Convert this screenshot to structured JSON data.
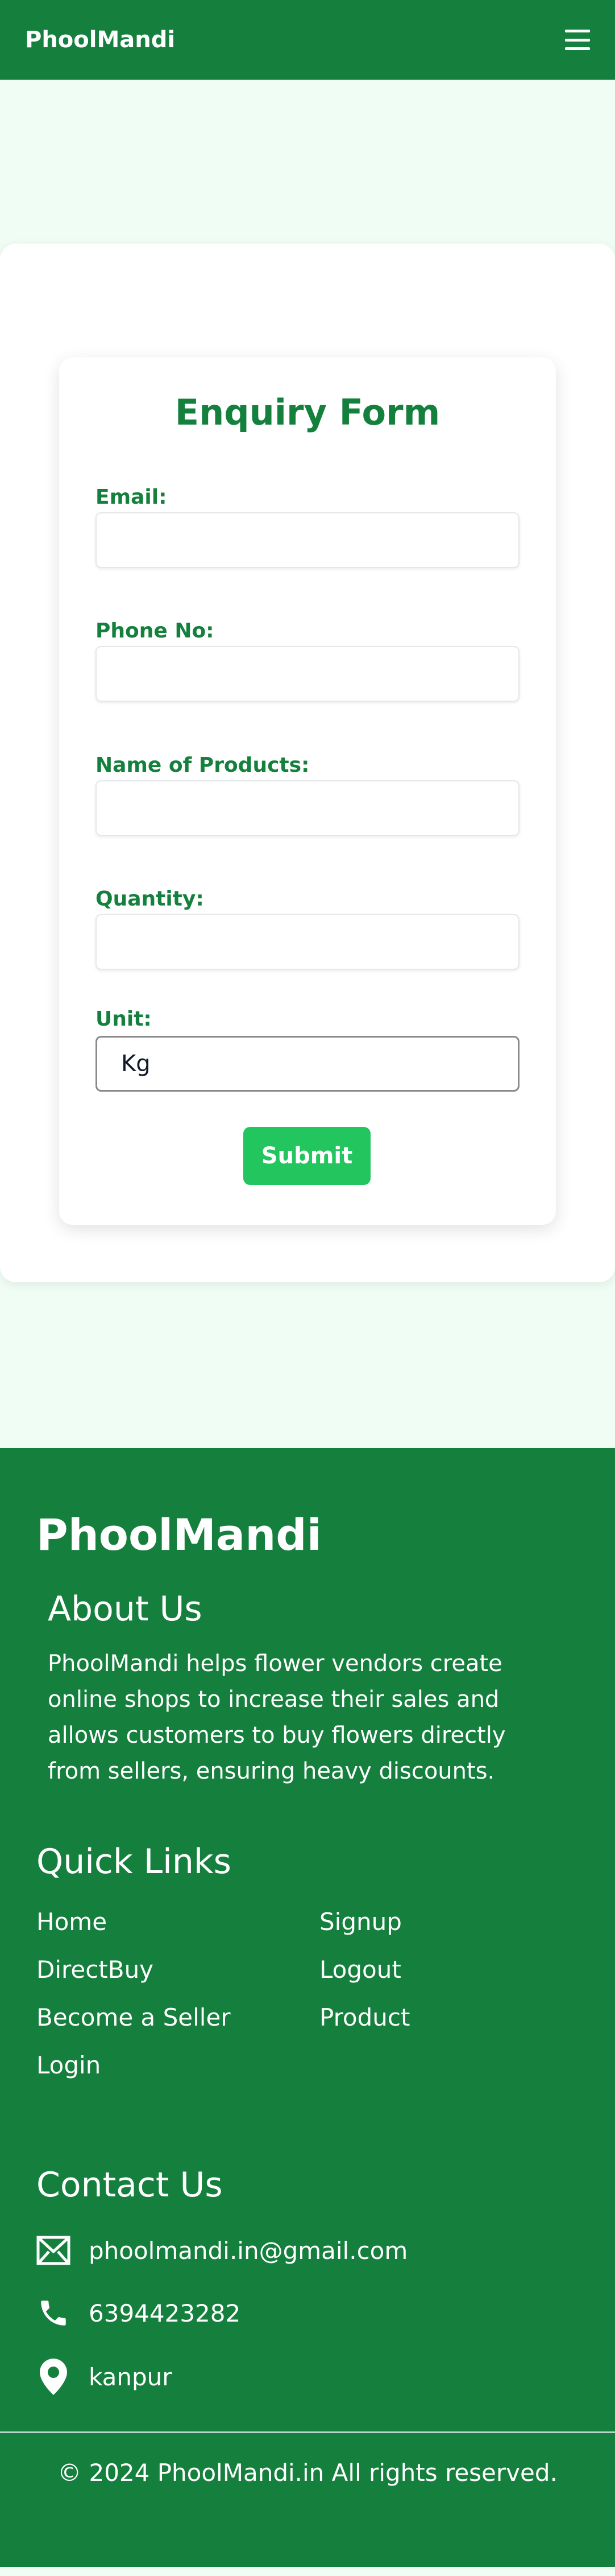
{
  "header": {
    "brand": "PhoolMandi",
    "menu_icon": "hamburger-menu-icon"
  },
  "form": {
    "title": "Enquiry Form",
    "fields": [
      {
        "label": "Email:",
        "value": ""
      },
      {
        "label": "Phone No:",
        "value": ""
      },
      {
        "label": "Name of Products:",
        "value": ""
      },
      {
        "label": "Quantity:",
        "value": ""
      },
      {
        "label": "Unit:",
        "value": "Kg"
      }
    ],
    "submit_label": "Submit"
  },
  "footer": {
    "brand": "PhoolMandi",
    "about": {
      "title": "About Us",
      "text": "PhoolMandi helps flower vendors create online shops to increase their sales and allows customers to buy flowers directly from sellers, ensuring heavy discounts."
    },
    "quick_links": {
      "title": "Quick Links",
      "items": [
        "Home",
        "DirectBuy",
        "Become a Seller",
        "Login",
        "Signup",
        "Logout",
        "Product"
      ]
    },
    "contact": {
      "title": "Contact Us",
      "email": "phoolmandi.in@gmail.com",
      "phone": "6394423282",
      "location": "kanpur"
    },
    "copyright": "© 2024 PhoolMandi.in All rights reserved."
  },
  "colors": {
    "brand_green": "#15803d",
    "button_green": "#22c55e",
    "page_background": "#f0fdf4"
  }
}
